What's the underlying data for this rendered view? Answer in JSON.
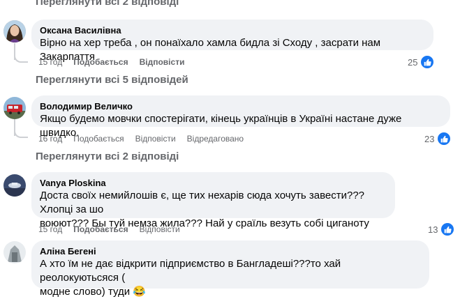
{
  "top_view_replies": "Переглянути всі 2 відповіді",
  "comments": [
    {
      "author": "Оксана Василівна",
      "text": "Вірно на хер треба , он понаїхало хамла бидла зі Сходу , засрати нам Закарпаття",
      "time": "15 год",
      "like_label": "Подобається",
      "reply_label": "Відповісти",
      "edited_label": "",
      "reaction_count": "25",
      "reaction_icon": "like-icon",
      "view_replies": "Переглянути всі 5 відповідей"
    },
    {
      "author": "Володимир Величко",
      "text": "Якщо будемо мовчки спостерігати, кінець українців в Україні настане дуже швидко.",
      "time": "16 год",
      "like_label": "Подобається",
      "reply_label": "Відповісти",
      "edited_label": "Відредаговано",
      "reaction_count": "23",
      "reaction_icon": "like-icon",
      "view_replies": "Переглянути всі 2 відповіді"
    },
    {
      "author": "Vanya Ploskina",
      "text_lines": [
        "Доста своїх немийлошів є, ще тих нехарів сюда хочуть завести??? Хлопці за шо",
        "воюют??? Бы туй немза жила??? Най у сраїль везуть собі циганоту"
      ],
      "time": "15 год",
      "like_label": "Подобається",
      "reply_label": "Відповісти",
      "reaction_count": "13",
      "reaction_icon": "like-icon"
    },
    {
      "author": "Аліна Бегені",
      "text_lines": [
        "А хто їм не дає відкрити підприємство в Бангладеші???то хай реолокуютьсяся (",
        "модне слово) туди"
      ],
      "emoji": "😂"
    }
  ],
  "colors": {
    "bubble_bg": "#f0f2f5",
    "secondary_text": "#65676b",
    "like_blue": "#1877f2",
    "thread_line": "#ced0d4"
  }
}
